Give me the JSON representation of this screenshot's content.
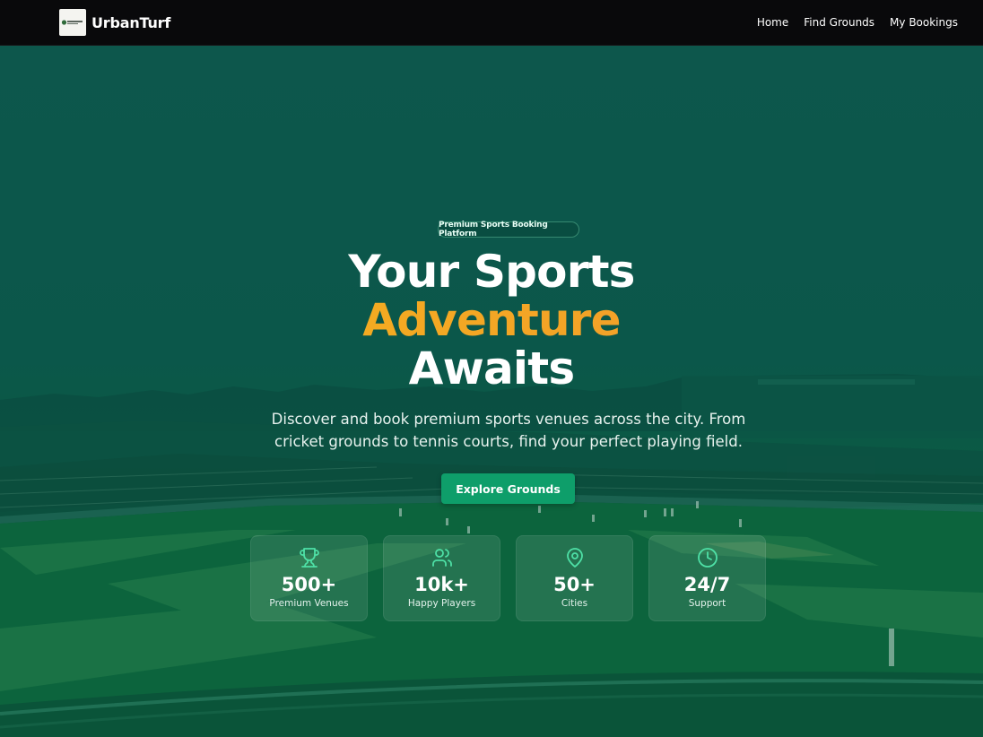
{
  "brand": {
    "name": "UrbanTurf",
    "logo_text": "UrbanTurf"
  },
  "nav": {
    "items": [
      {
        "label": "Home"
      },
      {
        "label": "Find Grounds"
      },
      {
        "label": "My Bookings"
      }
    ]
  },
  "hero": {
    "badge": "Premium Sports Booking Platform",
    "headline": {
      "line1": "Your Sports",
      "line2": "Adventure",
      "line3": "Awaits"
    },
    "description": "Discover and book premium sports venues across the city. From cricket grounds to tennis courts, find your perfect playing field.",
    "cta_label": "Explore Grounds"
  },
  "stats": [
    {
      "icon": "trophy-icon",
      "value": "500+",
      "label": "Premium Venues"
    },
    {
      "icon": "users-icon",
      "value": "10k+",
      "label": "Happy Players"
    },
    {
      "icon": "map-pin-icon",
      "value": "50+",
      "label": "Cities"
    },
    {
      "icon": "clock-icon",
      "value": "24/7",
      "label": "Support"
    }
  ],
  "colors": {
    "accent_green": "#0e9e6a",
    "icon_green": "#4ee0a6",
    "highlight_start": "#f5b619",
    "highlight_end": "#f08f3a",
    "topbar_bg": "#09090b"
  }
}
